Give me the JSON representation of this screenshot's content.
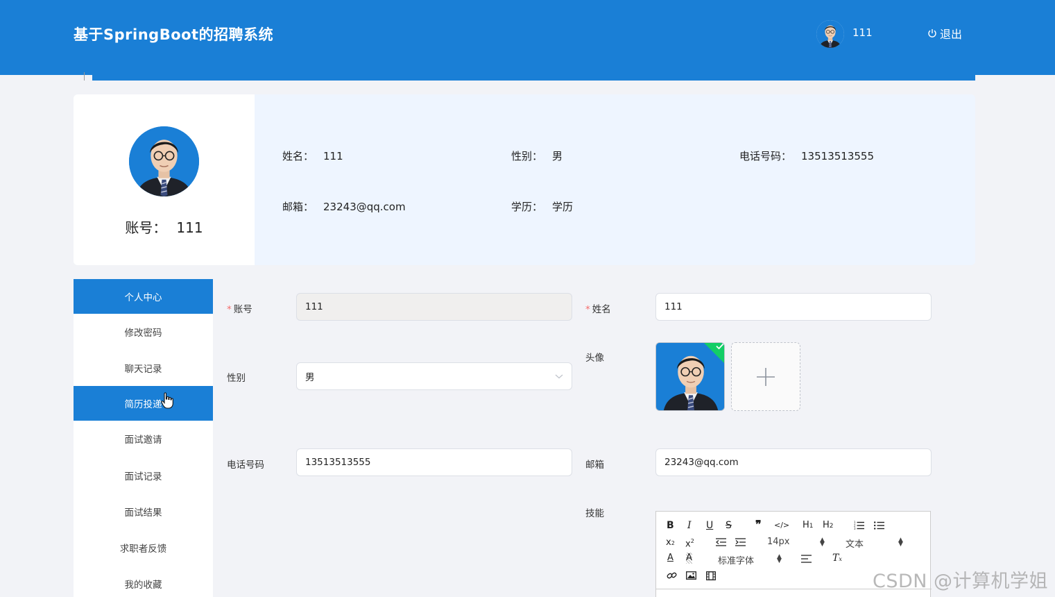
{
  "header": {
    "title": "基于SpringBoot的招聘系统",
    "username": "111",
    "logout_label": "退出"
  },
  "profile": {
    "account_label": "账号：",
    "account_value": "111",
    "fields": [
      {
        "label": "姓名：",
        "value": "111"
      },
      {
        "label": "性别：",
        "value": "男"
      },
      {
        "label": "电话号码：",
        "value": "13513513555"
      },
      {
        "label": "邮箱：",
        "value": "23243@qq.com"
      },
      {
        "label": "学历：",
        "value": "学历"
      }
    ]
  },
  "menu": {
    "items": [
      {
        "label": "个人中心",
        "active": true
      },
      {
        "label": "修改密码",
        "active": false
      },
      {
        "label": "聊天记录",
        "active": false
      },
      {
        "label": "简历投递",
        "active": true
      },
      {
        "label": "面试邀请",
        "active": false
      },
      {
        "label": "面试记录",
        "active": false
      },
      {
        "label": "面试结果",
        "active": false
      },
      {
        "label": "求职者反馈",
        "active": false
      },
      {
        "label": "我的收藏",
        "active": false
      }
    ]
  },
  "form": {
    "account": {
      "label": "账号",
      "value": "111",
      "required": "*"
    },
    "name": {
      "label": "姓名",
      "value": "111",
      "required": "*"
    },
    "avatar": {
      "label": "头像"
    },
    "gender": {
      "label": "性别",
      "value": "男"
    },
    "phone": {
      "label": "电话号码",
      "value": "13513513555"
    },
    "email": {
      "label": "邮箱",
      "value": "23243@qq.com"
    },
    "skills": {
      "label": "技能"
    }
  },
  "editor": {
    "font_size": "14px",
    "block_type": "文本",
    "font_family": "标准字体"
  },
  "watermark": "CSDN @计算机学姐",
  "colors": {
    "primary": "#1a7fd6",
    "success": "#13ce66",
    "required": "#f56c6c",
    "page_bg": "#f2f3f7"
  }
}
